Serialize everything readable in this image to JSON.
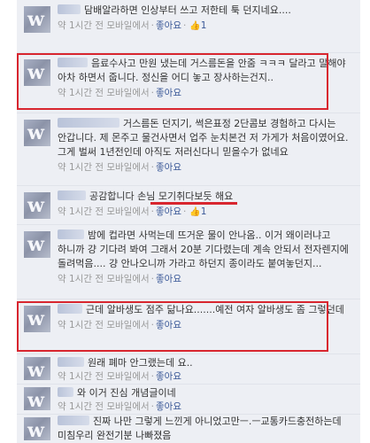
{
  "meta": {
    "time": "약 1시간 전",
    "device": "모바일에서",
    "like_label": "좋아요",
    "thumb_icon": "thumbs-up-icon"
  },
  "comments": [
    {
      "name": "",
      "text": "담배알라하면 인상부터 쓰고 저한테 툭 던지네요....",
      "likes": "1"
    },
    {
      "name": "",
      "text": "음료수사고 만원 냈는데 거스름돈을 안줌 ㅋㅋㅋ 달라고 말해야 아차 하면서 줍니다. 정신을 어디 놓고 장사하는건지..",
      "likes": ""
    },
    {
      "name": "",
      "text": "거스름돈 던지기, 썩은표정 2단콤보 경험하고 다시는 안갑니다. 제 몬주고 물건사면서 업주 눈치본건 저 가게가 처음이였어요. 그게 벌써 1년전인데 아직도 저러신다니 믿을수가 없네요",
      "likes": ""
    },
    {
      "name": "",
      "text": "공감합니다 손님 모기취다보듯 해요",
      "likes": "1"
    },
    {
      "name": "",
      "text": "밤에 컵라면 사먹는데 뜨거운 물이 안나옴.. 이거 왜이러냐고 하니까 걍 기다려 봐여 그래서 20분 기다렸는데 계속 안되서 전자렌지에 돌려먹음.... 걍 안나오니까 가라고 하던지 종이라도 붙여놓던지...",
      "likes": ""
    },
    {
      "name": "",
      "text": "근데 알바생도 점주 닮나요.......예전 여자 알바생도 좀 그렇던데",
      "likes": ""
    },
    {
      "name": "",
      "text": "원래 폐마 안그랬는데 요..",
      "likes": ""
    },
    {
      "name": "",
      "text": "와 이거 진심 개념글이네",
      "likes": ""
    },
    {
      "name": "",
      "text": "진짜 나만 그렇게 느낀게 아니었고만ㅡ.ㅡ교통카드충전하는데 미침우리 완전기분 나빠졌음",
      "likes": ""
    }
  ]
}
